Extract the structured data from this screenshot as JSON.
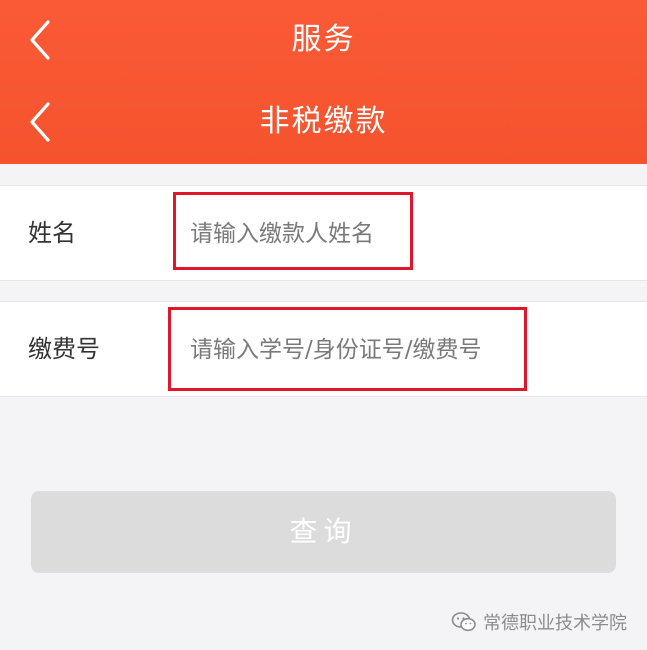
{
  "header": {
    "outer_title": "服务",
    "inner_title": "非税缴款",
    "back_icon": "chevron-left-icon",
    "color": "#f4532e"
  },
  "form": {
    "name": {
      "label": "姓名",
      "placeholder": "请输入缴款人姓名",
      "value": ""
    },
    "payment_number": {
      "label": "缴费号",
      "placeholder": "请输入学号/身份证号/缴费号",
      "value": ""
    },
    "highlight_color": "#e0162b"
  },
  "query_button": {
    "label": "查询",
    "state": "disabled"
  },
  "watermark": {
    "text": "常德职业技术学院",
    "icon": "wechat-icon"
  }
}
